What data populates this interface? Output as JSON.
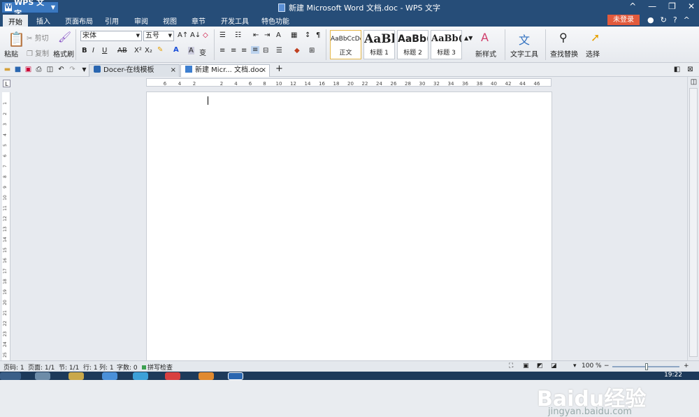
{
  "app": {
    "name": "WPS 文字",
    "window_title": "新建 Microsoft Word 文档.doc - WPS 文字"
  },
  "menu": {
    "items": [
      "开始",
      "插入",
      "页面布局",
      "引用",
      "审阅",
      "视图",
      "章节",
      "开发工具",
      "特色功能"
    ],
    "login": "未登录"
  },
  "ribbon": {
    "paste": "粘贴",
    "cut": "剪切",
    "copy": "复制",
    "format_painter": "格式刷",
    "font_name": "宋体",
    "font_size": "五号",
    "styles": [
      {
        "sample": "AaBbCcDd",
        "label": "正文"
      },
      {
        "sample": "AaBl",
        "label": "标题 1"
      },
      {
        "sample": "AaBb(",
        "label": "标题 2"
      },
      {
        "sample": "AaBb(",
        "label": "标题 3"
      }
    ],
    "new_style": "新样式",
    "text_tools": "文字工具",
    "find_replace": "查找替换",
    "select": "选择"
  },
  "tabs": [
    {
      "label": "Docer-在线模板"
    },
    {
      "label": "新建 Micr... 文档.doc"
    }
  ],
  "ruler": {
    "h_ticks": [
      "6",
      "4",
      "2",
      "2",
      "4",
      "6",
      "8",
      "10",
      "12",
      "14",
      "16",
      "18",
      "20",
      "22",
      "24",
      "26",
      "28",
      "30",
      "32",
      "34",
      "36",
      "38",
      "40",
      "42",
      "44",
      "46"
    ],
    "v_ticks": [
      "1",
      "2",
      "3",
      "4",
      "5",
      "6",
      "7",
      "8",
      "9",
      "10",
      "11",
      "12",
      "13",
      "14",
      "15",
      "16",
      "17",
      "18",
      "19",
      "20",
      "21",
      "22",
      "23",
      "24",
      "25"
    ]
  },
  "status": {
    "page_code": "页码: 1",
    "pages": "页面: 1/1",
    "section": "节: 1/1",
    "row": "行: 1",
    "col": "列: 1",
    "word_count": "字数: 0",
    "spell": "拼写检查",
    "zoom": "100 %"
  },
  "taskbar": {
    "clock": "19:22"
  },
  "watermark": {
    "brand": "Baidu经验",
    "url": "jingyan.baidu.com"
  }
}
